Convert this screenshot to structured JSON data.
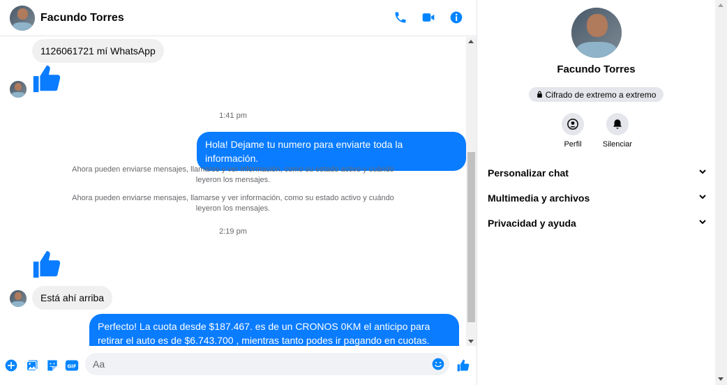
{
  "header": {
    "contact_name": "Facundo Torres"
  },
  "messages": {
    "in_1": "1126061721 mí WhatsApp",
    "time_1": "1:41 pm",
    "out_1": "Hola! Dejame tu numero  para enviarte toda la información.",
    "system_1": "Ahora pueden enviarse mensajes, llamarse y ver información, como su estado activo y cuándo leyeron los mensajes.",
    "system_2": "Ahora pueden enviarse mensajes, llamarse y ver información, como su estado activo y cuándo leyeron los mensajes.",
    "time_2": "2:19 pm",
    "in_2": "Está ahí arriba",
    "out_2": "Perfecto! La cuota desde $187.467. es de un CRONOS 0KM el anticipo para retirar el auto es de $6.743.700 , mientras tanto podes ir pagando en cuotas. Cuándo podes hablar? Así te asesoro en el auto?"
  },
  "composer": {
    "placeholder": "Aa"
  },
  "panel": {
    "contact_name": "Facundo Torres",
    "encryption": "Cifrado de extremo a extremo",
    "profile_label": "Perfil",
    "mute_label": "Silenciar",
    "sections": [
      "Personalizar chat",
      "Multimedia y archivos",
      "Privacidad y ayuda"
    ]
  },
  "colors": {
    "accent": "#0a7cff",
    "icon_blue": "#0084ff"
  }
}
